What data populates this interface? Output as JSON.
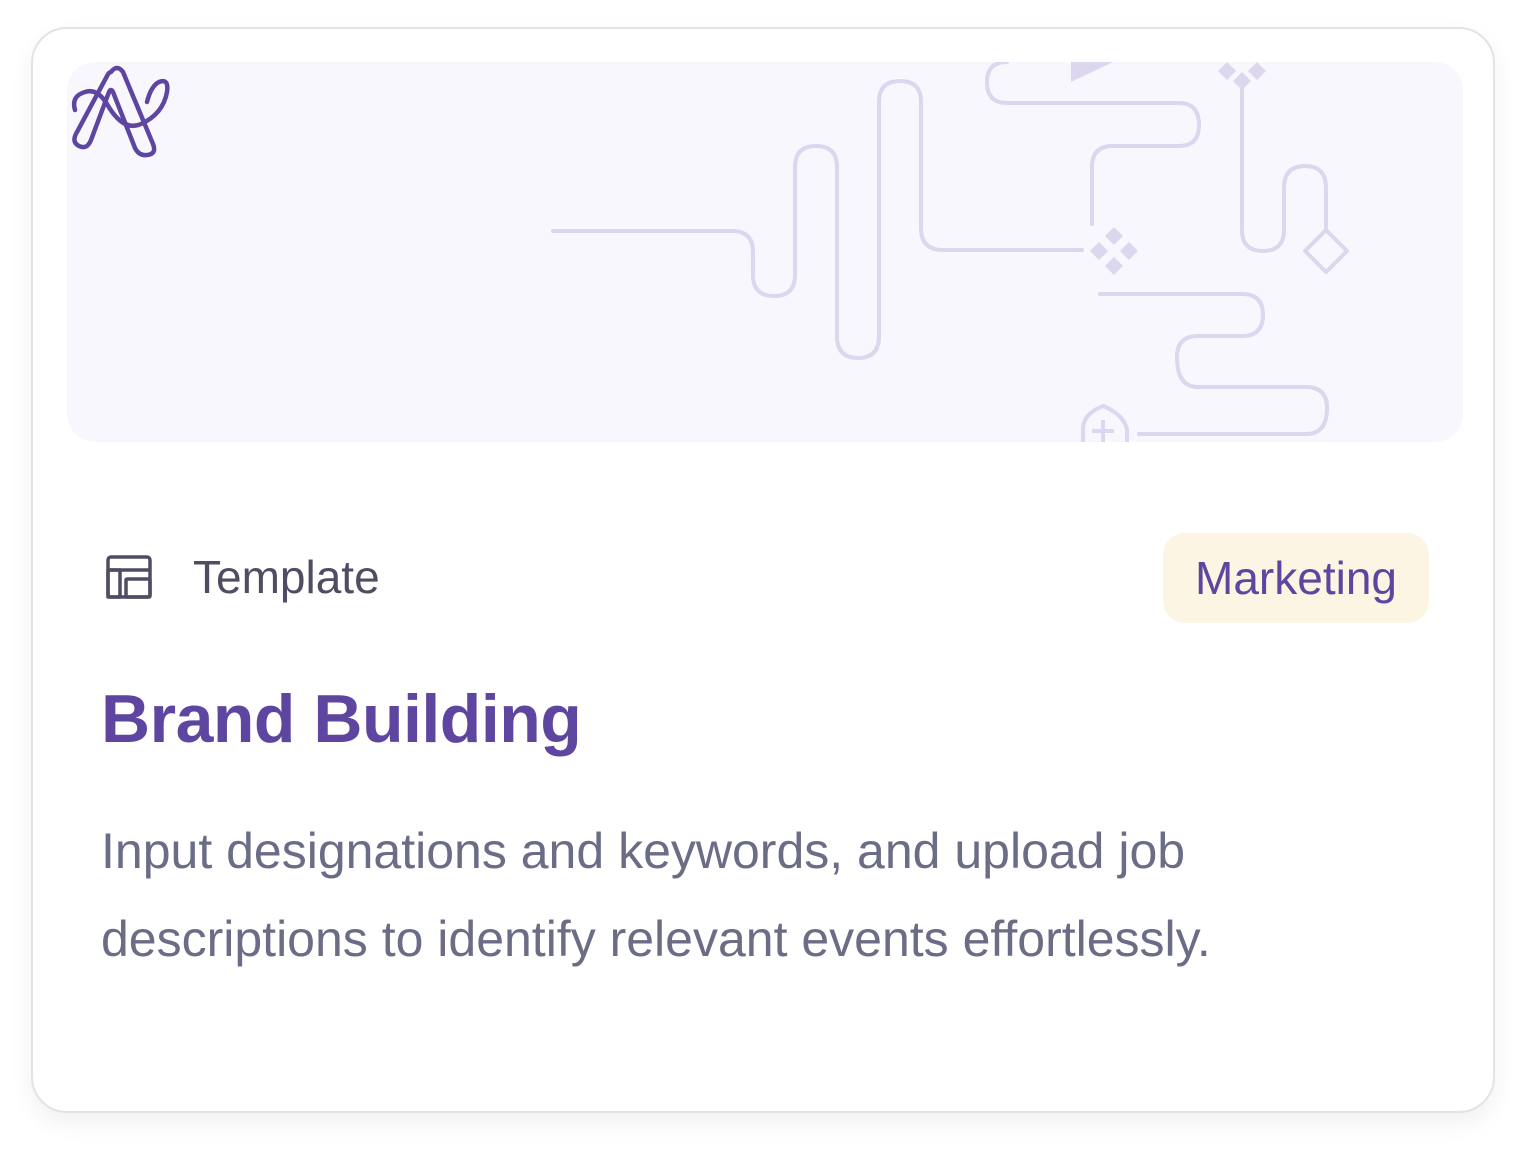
{
  "card": {
    "type_label": "Template",
    "category": "Marketing",
    "title": "Brand Building",
    "description": "Input designations and keywords, and upload job descriptions to identify relevant events effortlessly."
  },
  "icons": {
    "type": "template-layout-icon",
    "logo": "brand-logo-icon"
  },
  "colors": {
    "accent": "#5e46a0",
    "banner_bg": "#f8f7fd",
    "banner_lines": "#dcd6ee",
    "badge_bg": "#fdf5e3",
    "text_muted": "#6b6c86",
    "text_label": "#4f4d63"
  }
}
